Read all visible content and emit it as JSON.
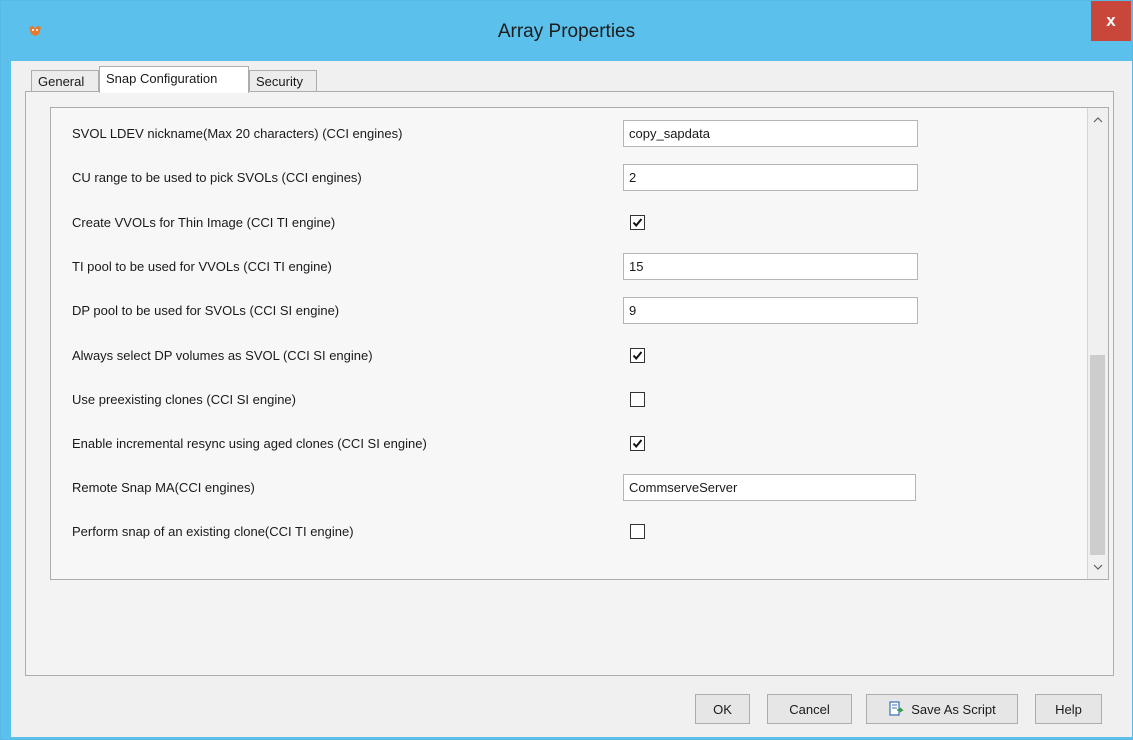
{
  "window": {
    "title": "Array Properties",
    "close_label": "x"
  },
  "tabs": [
    {
      "label": "General",
      "active": false
    },
    {
      "label": "Snap Configuration",
      "active": true
    },
    {
      "label": "Security",
      "active": false
    }
  ],
  "rows": [
    {
      "label": "SVOL LDEV nickname(Max 20 characters) (CCI engines)",
      "type": "text",
      "value": "copy_sapdata"
    },
    {
      "label": "CU range to be used to pick SVOLs (CCI engines)",
      "type": "text",
      "value": "2"
    },
    {
      "label": "Create VVOLs for Thin Image (CCI TI engine)",
      "type": "checkbox",
      "checked": true
    },
    {
      "label": "TI pool to be used for VVOLs (CCI TI engine)",
      "type": "text",
      "value": "15"
    },
    {
      "label": "DP pool to be used for SVOLs (CCI SI engine)",
      "type": "text",
      "value": "9"
    },
    {
      "label": "Always select DP volumes as SVOL (CCI SI engine)",
      "type": "checkbox",
      "checked": true
    },
    {
      "label": "Use preexisting clones (CCI SI engine)",
      "type": "checkbox",
      "checked": false
    },
    {
      "label": "Enable incremental resync using aged clones (CCI SI engine)",
      "type": "checkbox",
      "checked": true
    },
    {
      "label": "Remote Snap MA(CCI engines)",
      "type": "text",
      "value": "CommserveServer"
    },
    {
      "label": "Perform snap of an existing clone(CCI TI engine)",
      "type": "checkbox",
      "checked": false
    }
  ],
  "buttons": {
    "ok": "OK",
    "cancel": "Cancel",
    "save_as_script": "Save As Script",
    "help": "Help"
  },
  "icons": {
    "app": "app-logo-icon",
    "close": "close-icon",
    "scroll_up": "chevron-up-icon",
    "scroll_down": "chevron-down-icon",
    "script": "script-export-icon",
    "check": "checkmark-icon"
  },
  "colors": {
    "titlebar": "#5cc0ec",
    "close_button": "#c9473a"
  }
}
